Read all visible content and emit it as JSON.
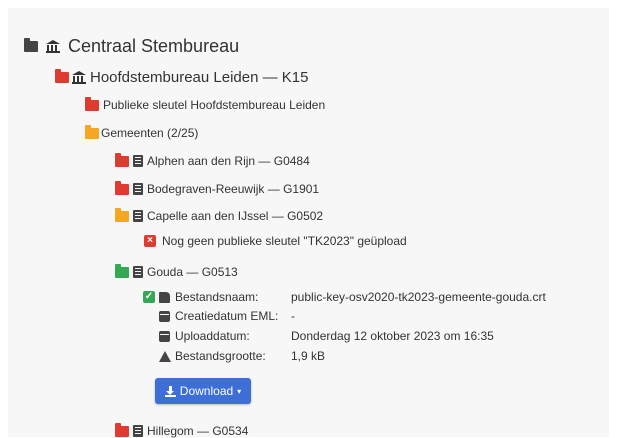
{
  "tree": {
    "root": {
      "label": "Centraal Stembureau",
      "icon": "folder-open-icon"
    },
    "hsb": {
      "label": "Hoofdstembureau Leiden — K15",
      "icon": "folder-open-icon"
    },
    "public_key": {
      "label": "Publieke sleutel Hoofdstembureau Leiden"
    },
    "gemeenten": {
      "label": "Gemeenten (2/25)"
    },
    "items": [
      {
        "label": "Alphen aan den Rijn — G0484"
      },
      {
        "label": "Bodegraven-Reeuwijk — G1901"
      },
      {
        "label": "Capelle aan den IJssel — G0502"
      },
      {
        "label": "Gouda — G0513"
      },
      {
        "label": "Hillegom — G0534"
      }
    ],
    "capelle_error": "Nog geen publieke sleutel \"TK2023\" geüpload",
    "gouda_details": {
      "filename_label": "Bestandsnaam:",
      "filename_value": "public-key-osv2020-tk2023-gemeente-gouda.crt",
      "eml_label": "Creatiedatum EML:",
      "eml_value": "-",
      "upload_label": "Uploaddatum:",
      "upload_value": "Donderdag 12 oktober 2023 om 16:35",
      "size_label": "Bestandsgrootte:",
      "size_value": "1,9 kB"
    },
    "download_label": "Download",
    "download_caret": "▾"
  },
  "colors": {
    "folder_closed": "#e03b30",
    "folder_open": "#f5a623",
    "folder_ok": "#35a853",
    "button": "#3d6fd6"
  }
}
